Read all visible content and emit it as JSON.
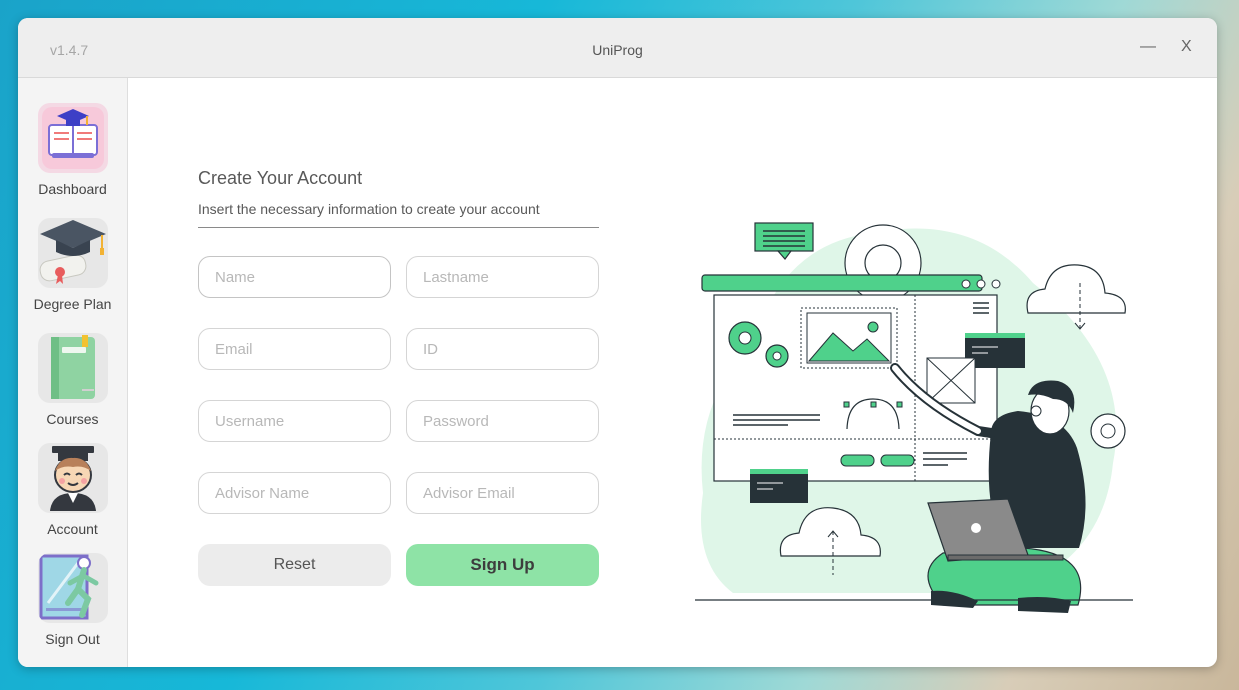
{
  "window": {
    "version": "v1.4.7",
    "title": "UniProg",
    "minimize_label": "—",
    "close_label": "X"
  },
  "sidebar": {
    "items": [
      {
        "label": "Dashboard",
        "icon": "book-graduation-cap-icon"
      },
      {
        "label": "Degree Plan",
        "icon": "diploma-cap-icon"
      },
      {
        "label": "Courses",
        "icon": "green-notebook-icon"
      },
      {
        "label": "Account",
        "icon": "graduate-avatar-icon"
      },
      {
        "label": "Sign Out",
        "icon": "exit-door-icon"
      }
    ]
  },
  "form": {
    "title": "Create Your Account",
    "subtitle": "Insert the necessary information to create your account",
    "fields": {
      "name": {
        "placeholder": "Name",
        "value": ""
      },
      "lastname": {
        "placeholder": "Lastname",
        "value": ""
      },
      "email": {
        "placeholder": "Email",
        "value": ""
      },
      "id": {
        "placeholder": "ID",
        "value": ""
      },
      "username": {
        "placeholder": "Username",
        "value": ""
      },
      "password": {
        "placeholder": "Password",
        "value": ""
      },
      "advisor_name": {
        "placeholder": "Advisor Name",
        "value": ""
      },
      "advisor_email": {
        "placeholder": "Advisor Email",
        "value": ""
      }
    },
    "reset_label": "Reset",
    "signup_label": "Sign Up"
  },
  "colors": {
    "accent_green": "#8ee3a6",
    "illustration_green": "#4fd18b",
    "dark": "#263238"
  }
}
